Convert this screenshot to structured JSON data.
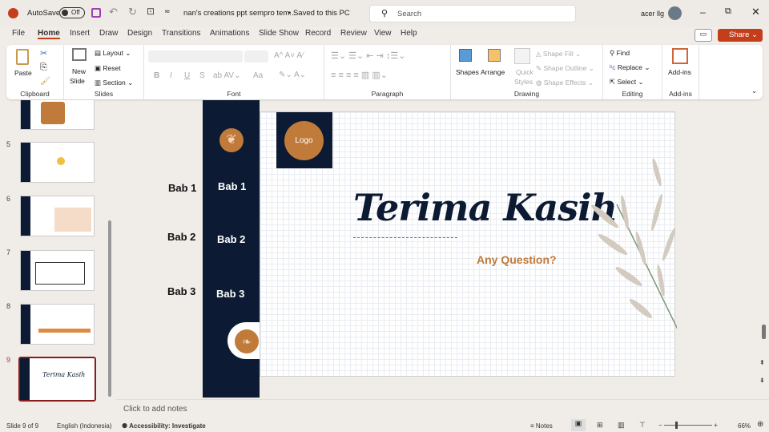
{
  "titlebar": {
    "autosave": "AutoSave",
    "toggle": "Off",
    "doc_title": "nan's creations ppt sempro tem...",
    "saved": "• Saved to this PC",
    "search_placeholder": "Search",
    "user": "acer llg"
  },
  "tabs": [
    "File",
    "Home",
    "Insert",
    "Draw",
    "Design",
    "Transitions",
    "Animations",
    "Slide Show",
    "Record",
    "Review",
    "View",
    "Help"
  ],
  "share": "Share",
  "ribbon": {
    "clipboard": {
      "label": "Clipboard",
      "paste": "Paste"
    },
    "slides": {
      "label": "Slides",
      "new_slide": "New",
      "new_slide2": "Slide",
      "layout": "Layout",
      "reset": "Reset",
      "section": "Section"
    },
    "font": {
      "label": "Font",
      "bold": "B",
      "italic": "I",
      "underline": "U",
      "strike": "S",
      "case": "Aa"
    },
    "paragraph": {
      "label": "Paragraph"
    },
    "drawing": {
      "label": "Drawing",
      "shapes": "Shapes",
      "arrange": "Arrange",
      "quick": "Quick",
      "styles": "Styles",
      "fill": "Shape Fill",
      "outline": "Shape Outline",
      "effects": "Shape Effects"
    },
    "editing": {
      "label": "Editing",
      "find": "Find",
      "replace": "Replace",
      "select": "Select"
    },
    "addins": {
      "label": "Add-ins",
      "addins": "Add-ins"
    }
  },
  "thumbnails": [
    {
      "num": "5"
    },
    {
      "num": "6"
    },
    {
      "num": "7"
    },
    {
      "num": "8"
    },
    {
      "num": "9",
      "title": "Terima Kasih"
    }
  ],
  "slide": {
    "logo": "Logo",
    "nav": [
      "Bab 1",
      "Bab 2",
      "Bab 3"
    ],
    "outside_labels": [
      "Bab 1",
      "Bab 2",
      "Bab 3"
    ],
    "title": "Terima Kasih",
    "subtitle": "Any Question?"
  },
  "notes_placeholder": "Click to add notes",
  "status": {
    "slide": "Slide 9 of 9",
    "language": "English (Indonesia)",
    "accessibility": "Accessibility: Investigate",
    "notes": "Notes",
    "zoom": "66%"
  },
  "colors": {
    "navy": "#0c1b33",
    "orange": "#c07a3a",
    "share": "#c43e1c"
  }
}
